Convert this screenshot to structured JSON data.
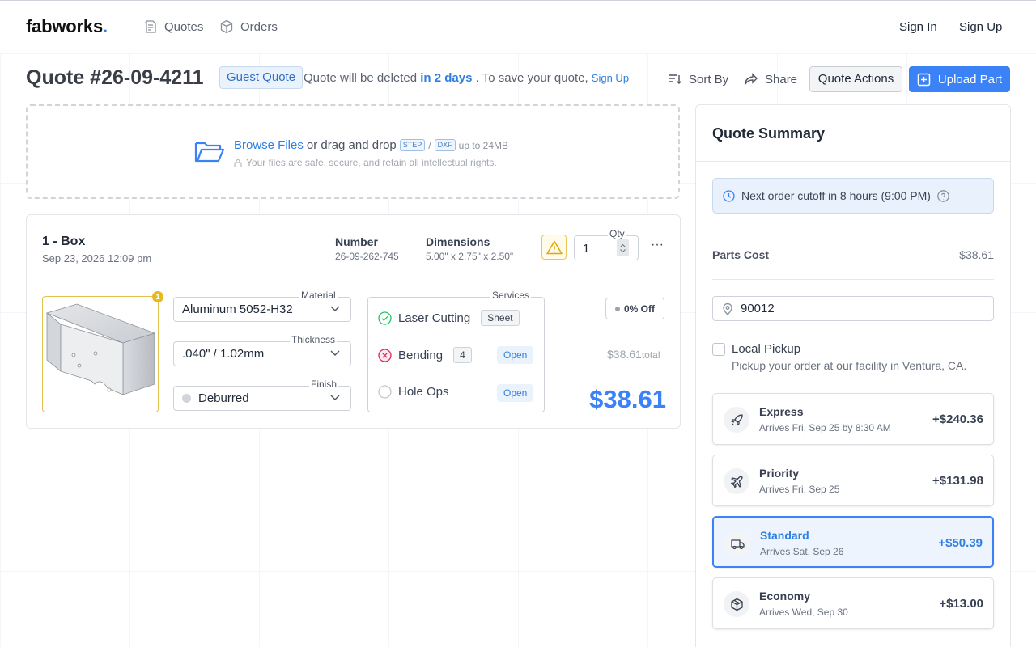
{
  "nav": {
    "logo": "fabworks",
    "logo_dot": ".",
    "quotes": "Quotes",
    "orders": "Orders",
    "sign_in": "Sign In",
    "sign_up": "Sign Up"
  },
  "header": {
    "title": "Quote #26-09-4211",
    "guest_badge": "Guest Quote",
    "delete_prefix": "Quote will be deleted",
    "delete_when": "in 2 days",
    "delete_suffix": ". To save your quote,",
    "sign_up_link": "Sign Up",
    "sort_by": "Sort By",
    "share": "Share",
    "quote_actions": "Quote Actions",
    "upload_part": "Upload Part"
  },
  "dropzone": {
    "browse": "Browse Files",
    "or_drag": "or drag and drop",
    "step_tag": "STEP",
    "slash": "/",
    "dxf_tag": "DXF",
    "size": "up to 24MB",
    "secure_note": "Your files are safe, secure, and retain all intellectual rights."
  },
  "part": {
    "name": "1 - Box",
    "date": "Sep 23, 2026 12:09 pm",
    "number_label": "Number",
    "number_value": "26-09-262-745",
    "dimensions_label": "Dimensions",
    "dimensions_value": "5.00\" x 2.75\" x 2.50\"",
    "qty_label": "Qty",
    "qty_value": "1",
    "more": "···",
    "thumb_badge": "1",
    "material_label": "Material",
    "material_value": "Aluminum 5052-H32",
    "thickness_label": "Thickness",
    "thickness_value": ".040\" / 1.02mm",
    "finish_label": "Finish",
    "finish_value": "Deburred",
    "services_label": "Services",
    "services": [
      {
        "name": "Laser Cutting",
        "tag": "Sheet",
        "status": "ok"
      },
      {
        "name": "Bending",
        "count": "4",
        "action": "Open",
        "status": "error"
      },
      {
        "name": "Hole Ops",
        "action": "Open",
        "status": "none"
      }
    ],
    "discount": "0% Off",
    "subtotal": "$38.61",
    "subtotal_suffix": "total",
    "price": "$38.61"
  },
  "summary": {
    "title": "Quote Summary",
    "cutoff": "Next order cutoff in 8 hours (9:00 PM)",
    "parts_cost_label": "Parts Cost",
    "parts_cost_value": "$38.61",
    "zip": "90012",
    "pickup_title": "Local Pickup",
    "pickup_sub": "Pickup your order at our facility in Ventura, CA.",
    "shipping": [
      {
        "name": "Express",
        "arrives": "Arrives Fri, Sep 25 by 8:30 AM",
        "price": "+$240.36",
        "icon": "rocket-icon",
        "selected": false
      },
      {
        "name": "Priority",
        "arrives": "Arrives Fri, Sep 25",
        "price": "+$131.98",
        "icon": "airplane-icon",
        "selected": false
      },
      {
        "name": "Standard",
        "arrives": "Arrives Sat, Sep 26",
        "price": "+$50.39",
        "icon": "truck-icon",
        "selected": true
      },
      {
        "name": "Economy",
        "arrives": "Arrives Wed, Sep 30",
        "price": "+$13.00",
        "icon": "box-icon",
        "selected": false
      }
    ]
  },
  "colors": {
    "accent": "#3b82f6",
    "warning": "#e7b91e",
    "error": "#e0245e",
    "success": "#22c55e"
  }
}
